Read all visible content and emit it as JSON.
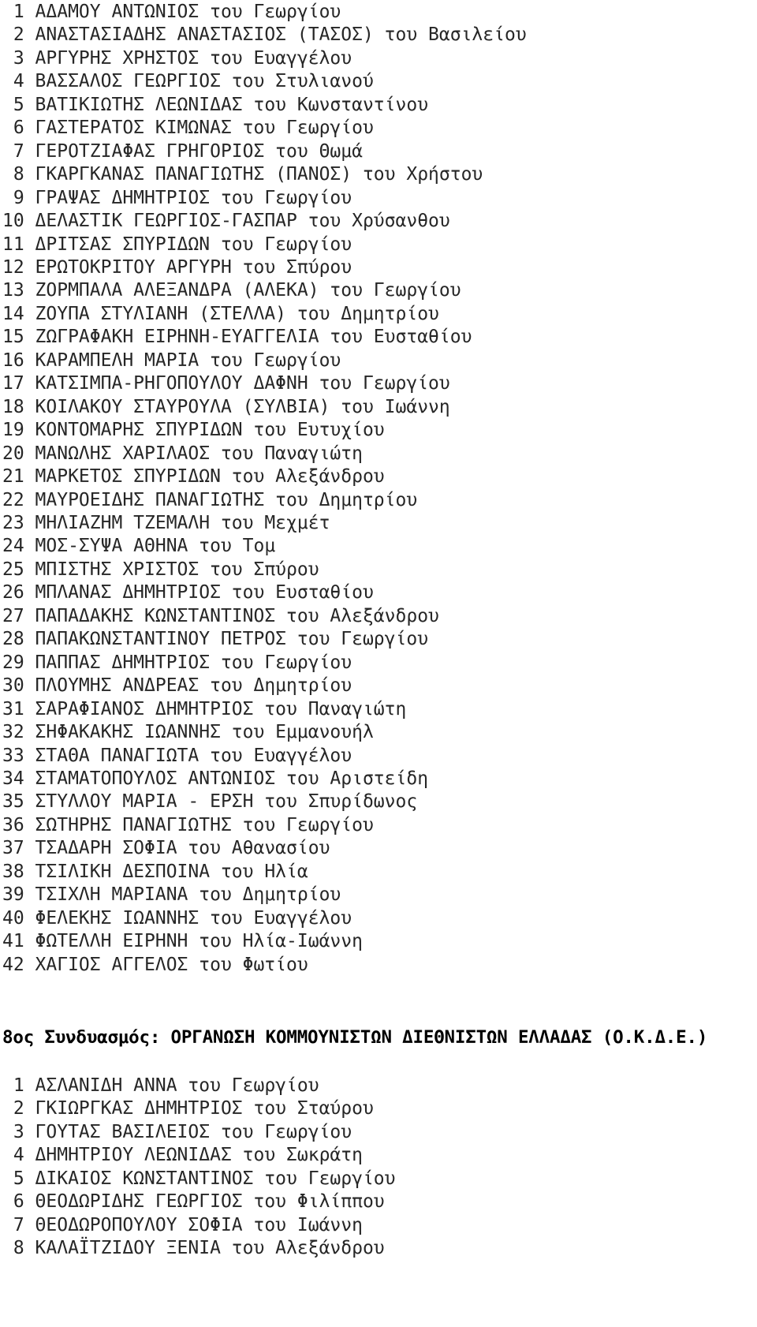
{
  "document": {
    "type": "election-candidate-listing"
  },
  "sections": [
    {
      "heading": null,
      "candidates": [
        {
          "index": "1",
          "name": "ΑΔΑΜΟΥ ΑΝΤΩΝΙΟΣ του Γεωργίου"
        },
        {
          "index": "2",
          "name": "ΑΝΑΣΤΑΣΙΑΔΗΣ ΑΝΑΣΤΑΣΙΟΣ (ΤΑΣΟΣ) του Βασιλείου"
        },
        {
          "index": "3",
          "name": "ΑΡΓΥΡΗΣ ΧΡΗΣΤΟΣ του Ευαγγέλου"
        },
        {
          "index": "4",
          "name": "ΒΑΣΣΑΛΟΣ ΓΕΩΡΓΙΟΣ του Στυλιανού"
        },
        {
          "index": "5",
          "name": "ΒΑΤΙΚΙΩΤΗΣ ΛΕΩΝΙΔΑΣ του Κωνσταντίνου"
        },
        {
          "index": "6",
          "name": "ΓΑΣΤΕΡΑΤΟΣ ΚΙΜΩΝΑΣ του Γεωργίου"
        },
        {
          "index": "7",
          "name": "ΓΕΡΟΤΖΙΑΦΑΣ ΓΡΗΓΟΡΙΟΣ του Θωμά"
        },
        {
          "index": "8",
          "name": "ΓΚΑΡΓΚΑΝΑΣ ΠΑΝΑΓΙΩΤΗΣ (ΠΑΝΟΣ) του Χρήστου"
        },
        {
          "index": "9",
          "name": "ΓΡΑΨΑΣ ΔΗΜΗΤΡΙΟΣ του Γεωργίου"
        },
        {
          "index": "10",
          "name": "ΔΕΛΑΣΤΙΚ ΓΕΩΡΓΙΟΣ-ΓΑΣΠΑΡ του Χρύσανθου"
        },
        {
          "index": "11",
          "name": "ΔΡΙΤΣΑΣ ΣΠΥΡΙΔΩΝ του Γεωργίου"
        },
        {
          "index": "12",
          "name": "ΕΡΩΤΟΚΡΙΤΟΥ ΑΡΓΥΡΗ του Σπύρου"
        },
        {
          "index": "13",
          "name": "ΖΟΡΜΠΑΛΑ ΑΛΕΞΑΝΔΡΑ (ΑΛΕΚΑ) του Γεωργίου"
        },
        {
          "index": "14",
          "name": "ΖΟΥΠΑ ΣΤΥΛΙΑΝΗ (ΣΤΕΛΛΑ) του Δημητρίου"
        },
        {
          "index": "15",
          "name": "ΖΩΓΡΑΦΑΚΗ ΕΙΡΗΝΗ-ΕΥΑΓΓΕΛΙΑ του Ευσταθίου"
        },
        {
          "index": "16",
          "name": "ΚΑΡΑΜΠΕΛΗ ΜΑΡΙΑ του Γεωργίου"
        },
        {
          "index": "17",
          "name": "ΚΑΤΣΙΜΠΑ-ΡΗΓΟΠΟΥΛΟΥ ΔΑΦΝΗ του Γεωργίου"
        },
        {
          "index": "18",
          "name": "ΚΟΙΛΑΚΟΥ ΣΤΑΥΡΟΥΛΑ (ΣΥΛΒΙΑ) του Ιωάννη"
        },
        {
          "index": "19",
          "name": "ΚΟΝΤΟΜΑΡΗΣ ΣΠΥΡΙΔΩΝ του Ευτυχίου"
        },
        {
          "index": "20",
          "name": "ΜΑΝΩΛΗΣ ΧΑΡΙΛΑΟΣ του Παναγιώτη"
        },
        {
          "index": "21",
          "name": "ΜΑΡΚΕΤΟΣ ΣΠΥΡΙΔΩΝ του Αλεξάνδρου"
        },
        {
          "index": "22",
          "name": "ΜΑΥΡΟΕΙΔΗΣ ΠΑΝΑΓΙΩΤΗΣ του Δημητρίου"
        },
        {
          "index": "23",
          "name": "ΜΗΛΙΑΖΗΜ ΤΖΕΜΑΛΗ του Μεχμέτ"
        },
        {
          "index": "24",
          "name": "ΜΟΣ-ΣΥΨΑ ΑΘΗΝΑ του Τομ"
        },
        {
          "index": "25",
          "name": "ΜΠΙΣΤΗΣ ΧΡΙΣΤΟΣ του Σπύρου"
        },
        {
          "index": "26",
          "name": "ΜΠΛΑΝΑΣ ΔΗΜΗΤΡΙΟΣ του Ευσταθίου"
        },
        {
          "index": "27",
          "name": "ΠΑΠΑΔΑΚΗΣ ΚΩΝΣΤΑΝΤΙΝΟΣ του Αλεξάνδρου"
        },
        {
          "index": "28",
          "name": "ΠΑΠΑΚΩΝΣΤΑΝΤΙΝΟΥ ΠΕΤΡΟΣ του Γεωργίου"
        },
        {
          "index": "29",
          "name": "ΠΑΠΠΑΣ ΔΗΜΗΤΡΙΟΣ του Γεωργίου"
        },
        {
          "index": "30",
          "name": "ΠΛΟΥΜΗΣ ΑΝΔΡΕΑΣ του Δημητρίου"
        },
        {
          "index": "31",
          "name": "ΣΑΡΑΦΙΑΝΟΣ ΔΗΜΗΤΡΙΟΣ του Παναγιώτη"
        },
        {
          "index": "32",
          "name": "ΣΗΦΑΚΑΚΗΣ ΙΩΑΝΝΗΣ του Εμμανουήλ"
        },
        {
          "index": "33",
          "name": "ΣΤΑΘΑ ΠΑΝΑΓΙΩΤΑ του Ευαγγέλου"
        },
        {
          "index": "34",
          "name": "ΣΤΑΜΑΤΟΠΟΥΛΟΣ ΑΝΤΩΝΙΟΣ του Αριστείδη"
        },
        {
          "index": "35",
          "name": "ΣΤΥΛΛΟΥ ΜΑΡΙΑ - ΕΡΣΗ του Σπυρίδωνος"
        },
        {
          "index": "36",
          "name": "ΣΩΤΗΡΗΣ ΠΑΝΑΓΙΩΤΗΣ του Γεωργίου"
        },
        {
          "index": "37",
          "name": "ΤΣΑΔΑΡΗ ΣΟΦΙΑ του Αθανασίου"
        },
        {
          "index": "38",
          "name": "ΤΣΙΛΙΚΗ ΔΕΣΠΟΙΝΑ του Ηλία"
        },
        {
          "index": "39",
          "name": "ΤΣΙΧΛΗ ΜΑΡΙΑΝΑ του Δημητρίου"
        },
        {
          "index": "40",
          "name": "ΦΕΛΕΚΗΣ ΙΩΑΝΝΗΣ του Ευαγγέλου"
        },
        {
          "index": "41",
          "name": "ΦΩΤΕΛΛΗ ΕΙΡΗΝΗ του Ηλία-Ιωάννη"
        },
        {
          "index": "42",
          "name": "ΧΑΓΙΟΣ ΑΓΓΕΛΟΣ του Φωτίου"
        }
      ]
    },
    {
      "heading": "8ος Συνδυασμός: ΟΡΓΑΝΩΣΗ ΚΟΜΜΟΥΝΙΣΤΩΝ ΔΙΕΘΝΙΣΤΩΝ ΕΛΛΑΔΑΣ (Ο.Κ.Δ.Ε.)",
      "candidates": [
        {
          "index": "1",
          "name": "ΑΣΛΑΝΙΔΗ ΑΝΝΑ του Γεωργίου"
        },
        {
          "index": "2",
          "name": "ΓΚΙΩΡΓΚΑΣ ΔΗΜΗΤΡΙΟΣ του Σταύρου"
        },
        {
          "index": "3",
          "name": "ΓΟΥΤΑΣ ΒΑΣΙΛΕΙΟΣ του Γεωργίου"
        },
        {
          "index": "4",
          "name": "ΔΗΜΗΤΡΙΟΥ ΛΕΩΝΙΔΑΣ του Σωκράτη"
        },
        {
          "index": "5",
          "name": "ΔΙΚΑΙΟΣ ΚΩΝΣΤΑΝΤΙΝΟΣ του Γεωργίου"
        },
        {
          "index": "6",
          "name": "ΘΕΟΔΩΡΙΔΗΣ ΓΕΩΡΓΙΟΣ του Φιλίππου"
        },
        {
          "index": "7",
          "name": "ΘΕΟΔΩΡΟΠΟΥΛΟΥ ΣΟΦΙΑ του Ιωάννη"
        },
        {
          "index": "8",
          "name": "ΚΑΛΑΪΤΖΙΔΟΥ ΞΕΝΙΑ του Αλεξάνδρου"
        }
      ]
    }
  ],
  "colors": {
    "text": "#262626",
    "heading": "#000000",
    "background": "#ffffff"
  }
}
